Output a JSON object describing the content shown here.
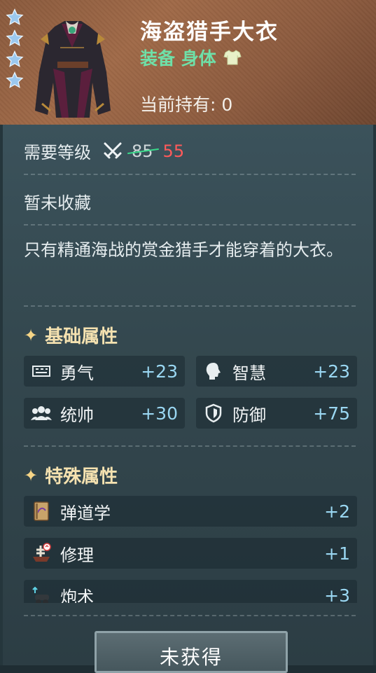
{
  "item": {
    "name": "海盗猎手大衣",
    "category": "装备 身体",
    "held_label": "当前持有: 0",
    "star_count": 4,
    "icon": "pirate-coat"
  },
  "requirement": {
    "label": "需要等级",
    "old_level": "85",
    "new_level": "55"
  },
  "collection_status": "暂未收藏",
  "description": "只有精通海战的赏金猎手才能穿着的大衣。",
  "basic_attributes": {
    "title": "基础属性",
    "items": [
      {
        "name": "勇气",
        "value": "+23",
        "icon": "courage-icon"
      },
      {
        "name": "智慧",
        "value": "+23",
        "icon": "wisdom-icon"
      },
      {
        "name": "统帅",
        "value": "+30",
        "icon": "command-icon"
      },
      {
        "name": "防御",
        "value": "+75",
        "icon": "shield-icon"
      }
    ]
  },
  "special_attributes": {
    "title": "特殊属性",
    "items": [
      {
        "name": "弹道学",
        "value": "+2",
        "icon": "ballistics-book-icon"
      },
      {
        "name": "修理",
        "value": "+1",
        "icon": "repair-ship-icon"
      },
      {
        "name": "炮术",
        "value": "+3",
        "icon": "cannon-icon"
      }
    ]
  },
  "action_button": "未获得",
  "colors": {
    "header_bg": "#a06a48",
    "category_green": "#6ee0a8",
    "new_level_red": "#ff5a5a",
    "stat_value_blue": "#9ad7f2",
    "section_title": "#f5e2b0"
  }
}
